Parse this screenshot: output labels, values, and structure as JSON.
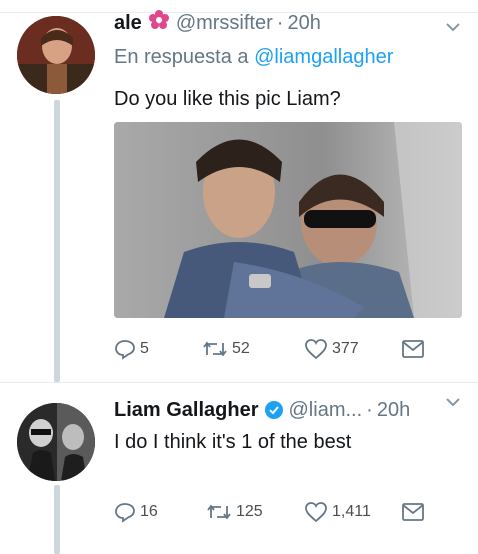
{
  "tweets": [
    {
      "name": "ale",
      "handle": "@mrssifter",
      "dot": "·",
      "time": "20h",
      "reply_prefix": "En respuesta a",
      "reply_to": "@liamgallagher",
      "text": "Do you like this pic Liam?",
      "actions": {
        "replies": "5",
        "retweets": "52",
        "likes": "377"
      },
      "icons": [
        "reply-icon",
        "retweet-icon",
        "heart-icon",
        "dm-envelope-icon"
      ]
    },
    {
      "name": "Liam Gallagher",
      "handle": "@liam...",
      "dot": "·",
      "time": "20h",
      "text": "I do I think it's 1 of the best",
      "actions": {
        "replies": "16",
        "retweets": "125",
        "likes": "1,411"
      }
    }
  ],
  "colors": {
    "primary_text": "#14171a",
    "secondary_text": "#657786",
    "link": "#1da1f2",
    "verified": "#1da1f2",
    "flower": "#e0478c",
    "thread_line": "#ccd6dd"
  }
}
